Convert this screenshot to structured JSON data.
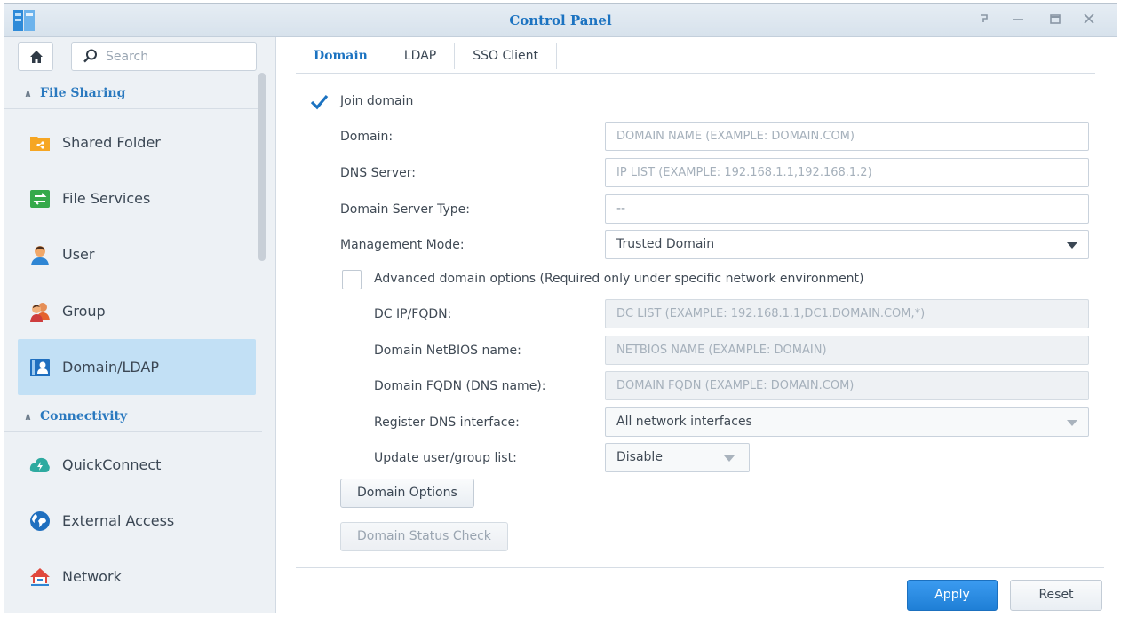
{
  "window": {
    "title": "Control Panel",
    "buttons": [
      "help-button",
      "minimize-button",
      "maximize-button",
      "close-button"
    ]
  },
  "sidebar": {
    "search": {
      "placeholder": "Search"
    },
    "sections": [
      {
        "label": "File Sharing"
      },
      {
        "label": "Connectivity"
      }
    ],
    "items": [
      {
        "label": "Shared Folder",
        "icon": "shared-folder-icon",
        "color": "#f6a623"
      },
      {
        "label": "File Services",
        "icon": "file-services-icon",
        "color": "#35a94a"
      },
      {
        "label": "User",
        "icon": "user-icon",
        "color": "#e89b5c"
      },
      {
        "label": "Group",
        "icon": "group-icon",
        "color": "#e89b5c"
      },
      {
        "label": "Domain/LDAP",
        "icon": "domain-ldap-icon",
        "color": "#1f6fbf",
        "active": true
      },
      {
        "label": "QuickConnect",
        "icon": "quickconnect-icon",
        "color": "#2eaaa0"
      },
      {
        "label": "External Access",
        "icon": "globe-icon",
        "color": "#1f6fbf"
      },
      {
        "label": "Network",
        "icon": "network-icon",
        "color": "#e0483d"
      }
    ]
  },
  "tabs": [
    {
      "label": "Domain",
      "active": true
    },
    {
      "label": "LDAP"
    },
    {
      "label": "SSO Client"
    }
  ],
  "form": {
    "join_domain": {
      "label": "Join domain",
      "checked": true
    },
    "domain": {
      "label": "Domain:",
      "placeholder": "DOMAIN NAME (EXAMPLE: DOMAIN.COM)"
    },
    "dns_server": {
      "label": "DNS Server:",
      "placeholder": "IP LIST (EXAMPLE: 192.168.1.1,192.168.1.2)"
    },
    "domain_server_type": {
      "label": "Domain Server Type:",
      "value": "--"
    },
    "management_mode": {
      "label": "Management Mode:",
      "value": "Trusted Domain"
    },
    "advanced": {
      "label": "Advanced domain options (Required only under specific network environment)",
      "checked": false
    },
    "dc_ip": {
      "label": "DC IP/FQDN:",
      "placeholder": "DC LIST (EXAMPLE: 192.168.1.1,DC1.DOMAIN.COM,*)"
    },
    "netbios": {
      "label": "Domain NetBIOS name:",
      "placeholder": "NETBIOS NAME (EXAMPLE: DOMAIN)"
    },
    "fqdn": {
      "label": "Domain FQDN (DNS name):",
      "placeholder": "DOMAIN FQDN (EXAMPLE: DOMAIN.COM)"
    },
    "register_dns": {
      "label": "Register DNS interface:",
      "value": "All network interfaces"
    },
    "update_list": {
      "label": "Update user/group list:",
      "value": "Disable"
    },
    "domain_options_label": "Domain Options",
    "domain_status_label": "Domain Status Check"
  },
  "footer": {
    "apply_label": "Apply",
    "reset_label": "Reset"
  },
  "colors": {
    "accent": "#1c73c1",
    "active_item": "#c2e0f5",
    "primary_button": "#2a8ce6"
  }
}
